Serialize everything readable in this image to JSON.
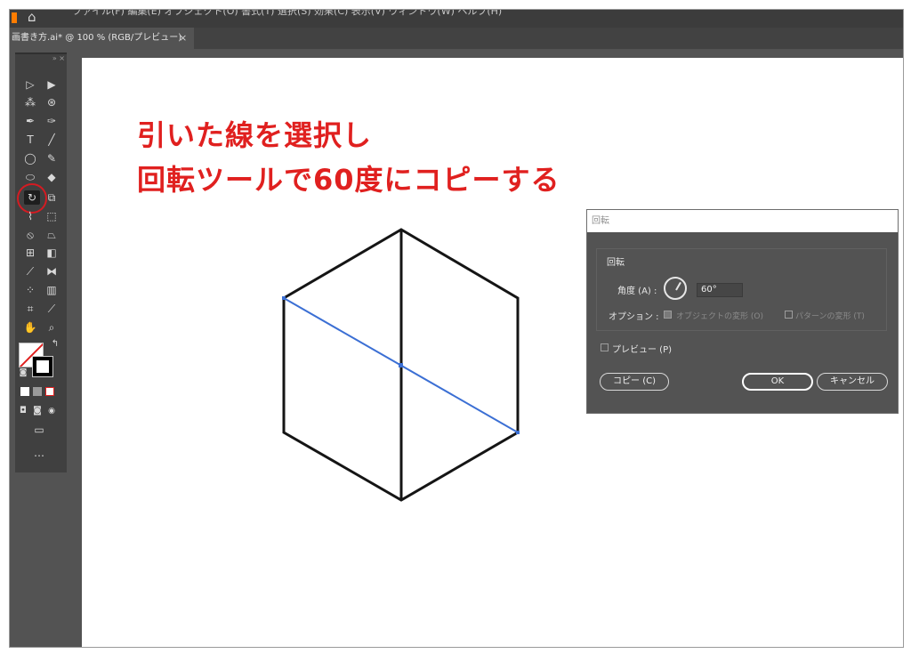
{
  "app": {
    "menu_text": "ファイル(F)  編集(E)  オブジェクト(O)  書式(T)  選択(S)  効果(C)  表示(V)  ウィンドウ(W)  ヘルプ(H)",
    "tab_title": "画書き方.ai* @ 100 % (RGB/プレビュー)",
    "tab_close": "×"
  },
  "toolbar": {
    "grip": "» ×",
    "more": "…",
    "active_tool": "rotate-tool",
    "icons": {
      "selection": "▷",
      "direct_selection": "▶",
      "magic_wand": "⁂",
      "lasso": "⊛",
      "pen": "✒",
      "curvature": "✑",
      "type": "T",
      "line": "╱",
      "ellipse": "◯",
      "paintbrush": "✎",
      "shaper": "⬭",
      "eraser": "◆",
      "rotate": "↻",
      "scale": "⧉",
      "width": "⌇",
      "free_transform": "⬚",
      "shape_builder": "⦸",
      "perspective": "⏢",
      "mesh": "⊞",
      "gradient": "◧",
      "eyedropper": "⟋",
      "blend": "⧓",
      "symbol_sprayer": "⁘",
      "column_graph": "▥",
      "artboard": "⌗",
      "slice": "⟋",
      "hand": "✋",
      "zoom": "⌕",
      "swap": "↰",
      "default_colors": "◙",
      "draw_normal": "◘",
      "draw_behind": "◙",
      "draw_inside": "◉",
      "screen_mode": "▭"
    }
  },
  "canvas": {
    "heading_line1": "引いた線を選択し",
    "heading_line2": "回転ツールで60度にコピーする",
    "heading_color": "#e0201f",
    "selection_color": "#3b6fd4"
  },
  "dialog": {
    "title": "回転",
    "group_label": "回転",
    "angle_label": "角度 (A) :",
    "angle_value": "60°",
    "options_label": "オプション :",
    "option_objects": "オブジェクトの変形 (O)",
    "option_patterns": "パターンの変形 (T)",
    "preview_label": "プレビュー (P)",
    "copy_button": "コピー (C)",
    "ok_button": "OK",
    "cancel_button": "キャンセル"
  }
}
